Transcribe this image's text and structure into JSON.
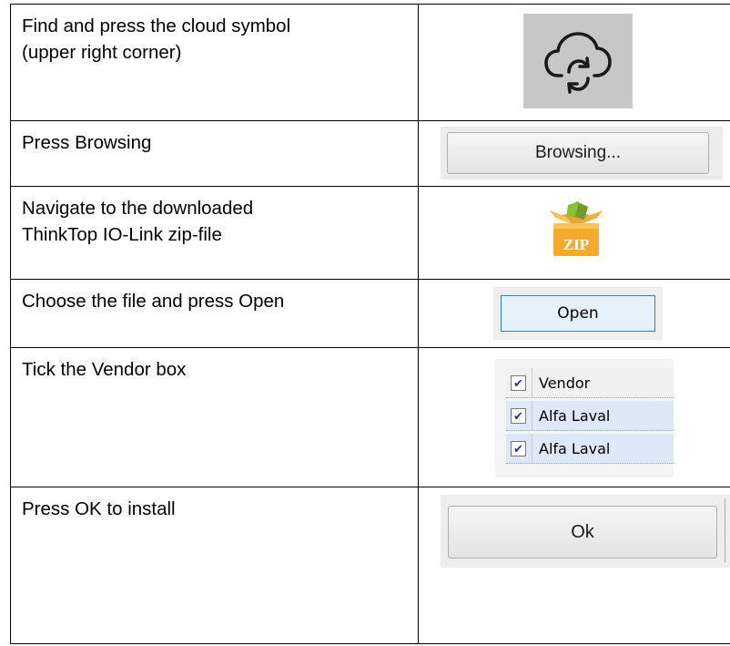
{
  "steps": [
    {
      "text": "Find and press the cloud symbol\n(upper right corner)",
      "icon": "cloud-sync-icon"
    },
    {
      "text": "Press Browsing",
      "button_label": "Browsing..."
    },
    {
      "text": "Navigate to the downloaded\nThinkTop IO-Link zip-file",
      "icon": "zip-archive-icon",
      "icon_label": "ZIP"
    },
    {
      "text": "Choose the file and press Open",
      "button_label": "Open"
    },
    {
      "text": "Tick the Vendor box",
      "vendor_list": {
        "header": "Vendor",
        "items": [
          "Alfa Laval",
          "Alfa Laval"
        ],
        "checked": [
          true,
          true,
          true
        ]
      }
    },
    {
      "text": "Press OK to install",
      "button_label": "Ok"
    }
  ],
  "colors": {
    "cloud_tile": "#c7c7c7",
    "open_border": "#3c7fb1",
    "vendor_row_bg": "#dde8f8"
  }
}
